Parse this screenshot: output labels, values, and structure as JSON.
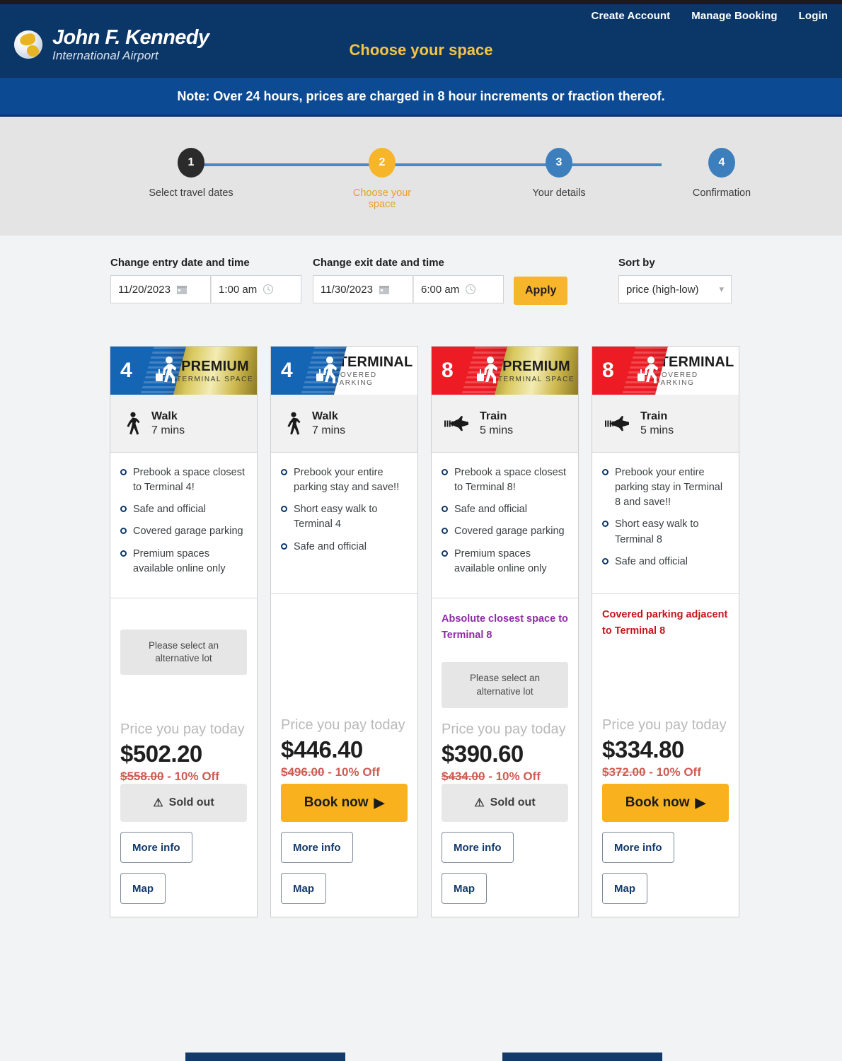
{
  "topnav": {
    "items": [
      {
        "label": "Create Account",
        "name": "create-account"
      },
      {
        "label": "Manage Booking",
        "name": "manage-booking"
      },
      {
        "label": "Login",
        "name": "login"
      }
    ]
  },
  "brand": {
    "line1": "John F. Kennedy",
    "line2": "International Airport"
  },
  "header": {
    "page_title": "Choose your space"
  },
  "note": {
    "text": "Note: Over 24 hours, prices are charged in 8 hour increments or fraction thereof."
  },
  "stepper": {
    "steps": [
      {
        "num": "1",
        "label": "Select travel dates",
        "state": "done"
      },
      {
        "num": "2",
        "label": "Choose your space",
        "state": "current"
      },
      {
        "num": "3",
        "label": "Your details",
        "state": "upcoming"
      },
      {
        "num": "4",
        "label": "Confirmation",
        "state": "upcoming"
      }
    ]
  },
  "controls": {
    "entry_label": "Change entry date and time",
    "entry_date": "11/20/2023",
    "entry_time": "1:00 am",
    "exit_label": "Change exit date and time",
    "exit_date": "11/30/2023",
    "exit_time": "6:00 am",
    "apply_label": "Apply",
    "sort_label": "Sort by",
    "sort_value": "price (high-low)"
  },
  "colors": {
    "header_navy": "#0b3668",
    "note_blue": "#0c4a93",
    "amber": "#f7b52c",
    "gold": "#d9c95f",
    "red": "#ed1c24",
    "blue": "#1565b5",
    "promo_purple": "#8e2ba5",
    "promo_red": "#c4161c",
    "strike_red": "#cf5b52"
  },
  "cards": [
    {
      "terminal": "4",
      "banner_title": "PREMIUM",
      "banner_sub": "TERMINAL SPACE",
      "banner_style": "blue-gold",
      "transit_mode": "Walk",
      "transit_icon": "walk-icon",
      "transit_time": "7 mins",
      "features": [
        "Prebook a space closest to Terminal 4!",
        "Safe and official",
        "Covered garage parking",
        "Premium spaces available online only"
      ],
      "promo": "",
      "alt_lot_notice": "Please select an alternative lot",
      "price_label": "Price you pay today",
      "price_now": "$502.20",
      "price_was": "$558.00",
      "discount": "- 10% Off",
      "cta_label": "Sold out",
      "cta_state": "sold",
      "more_info_label": "More info",
      "map_label": "Map"
    },
    {
      "terminal": "4",
      "banner_title": "TERMINAL",
      "banner_sub": "COVERED PARKING",
      "banner_style": "blue-white",
      "transit_mode": "Walk",
      "transit_icon": "walk-icon",
      "transit_time": "7 mins",
      "features": [
        "Prebook your entire parking stay and save!!",
        "Short easy walk to Terminal 4",
        "Safe and official"
      ],
      "promo": "",
      "alt_lot_notice": "",
      "price_label": "Price you pay today",
      "price_now": "$446.40",
      "price_was": "$496.00",
      "discount": "- 10% Off",
      "cta_label": "Book now",
      "cta_state": "book",
      "more_info_label": "More info",
      "map_label": "Map"
    },
    {
      "terminal": "8",
      "banner_title": "PREMIUM",
      "banner_sub": "TERMINAL SPACE",
      "banner_style": "red-gold",
      "transit_mode": "Train",
      "transit_icon": "train-plane-icon",
      "transit_time": "5 mins",
      "features": [
        "Prebook a space closest to Terminal 8!",
        "Safe and official",
        "Covered garage parking",
        "Premium spaces available online only"
      ],
      "promo": "Absolute closest space to Terminal 8",
      "promo_color": "purple",
      "alt_lot_notice": "Please select an alternative lot",
      "price_label": "Price you pay today",
      "price_now": "$390.60",
      "price_was": "$434.00",
      "discount": "- 10% Off",
      "cta_label": "Sold out",
      "cta_state": "sold",
      "more_info_label": "More info",
      "map_label": "Map"
    },
    {
      "terminal": "8",
      "banner_title": "TERMINAL",
      "banner_sub": "COVERED PARKING",
      "banner_style": "red-white",
      "transit_mode": "Train",
      "transit_icon": "train-plane-icon",
      "transit_time": "5 mins",
      "features": [
        "Prebook your entire parking stay in Terminal 8 and save!!",
        "Short easy walk to Terminal 8",
        "Safe and official"
      ],
      "promo": "Covered parking adjacent to Terminal 8",
      "promo_color": "red",
      "alt_lot_notice": "",
      "price_label": "Price you pay today",
      "price_now": "$334.80",
      "price_was": "$372.00",
      "discount": "- 10% Off",
      "cta_label": "Book now",
      "cta_state": "book",
      "more_info_label": "More info",
      "map_label": "Map"
    }
  ]
}
